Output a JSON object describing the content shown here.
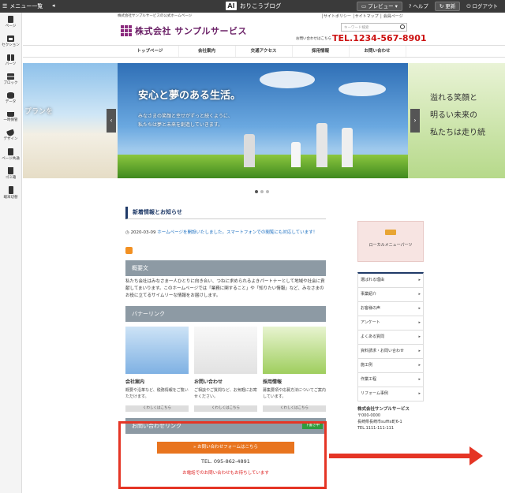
{
  "toolbar": {
    "menu_label": "メニュー一覧",
    "collapse_glyph": "◂",
    "brand": "おりこうブログ",
    "brand_mark": "AI",
    "preview": "プレビュー",
    "help": "ヘルプ",
    "update": "更新",
    "logout": "ログアウト"
  },
  "sidebar": {
    "items": [
      {
        "label": "ページ",
        "icon": "page-icon"
      },
      {
        "label": "セクション",
        "icon": "section-icon"
      },
      {
        "label": "パーツ",
        "icon": "parts-icon"
      },
      {
        "label": "ブロック",
        "icon": "block-icon"
      },
      {
        "label": "データ",
        "icon": "database-icon"
      },
      {
        "label": "一時保管",
        "icon": "tray-icon"
      },
      {
        "label": "デザイン",
        "icon": "paint-bucket-icon"
      },
      {
        "label": "ページ共通",
        "icon": "common-page-icon"
      },
      {
        "label": "ゴミ箱",
        "icon": "trash-icon"
      },
      {
        "label": "端末切替",
        "icon": "phone-icon"
      }
    ]
  },
  "site": {
    "tagline": "株式会社サンプルサービスの公式ホームページ",
    "top_links": "│サイトポリシー │サイトマップ │ 会員ページ",
    "logo_text": "株式会社 サンプルサービス",
    "search_placeholder": "キーワード検索",
    "tel_note": "お問い合わせはこちら",
    "tel": "TEL.1234-567-8901",
    "nav": [
      "トップページ",
      "会社案内",
      "交通アクセス",
      "採用情報",
      "お問い合わせ"
    ],
    "hero": {
      "left_text": "プランを",
      "title": "安心と夢のある生活。",
      "subtitle": "みなさまの笑顔と幸せがずっと続くように、\n私たちは夢と未来を創造していきます。",
      "right_text": "溢れる笑顔と\n明るい未来の\n私たちは走り続",
      "prev_glyph": "‹",
      "next_glyph": "›"
    },
    "news": {
      "title": "新着情報とお知らせ",
      "date": "2020-03-09",
      "text": "ホームページを開設いたしました。スマートフォンでの閲覧にも対応しています！"
    },
    "overview": {
      "title": "概要文",
      "text": "私たち会社はみなさま一人ひとりに向き合い、つねに求められるよきパートナーとして地域や社会に貢献してまいります。このホームページでは「業務に関すること」や「知りたい情報」など、みなさまのお役に立てるサイムリーな情報をお届けします。"
    },
    "banner": {
      "title": "バナーリンク",
      "cards": [
        {
          "title": "会社案内",
          "text": "概要や沿革など、税務情報をご覧いただけます。",
          "more": "くわしくはこちら"
        },
        {
          "title": "お問い合わせ",
          "text": "ご相談やご質問など、お気軽にお寄せください。",
          "more": "くわしくはこちら"
        },
        {
          "title": "採用情報",
          "text": "募集要項や応募方法についてご案内しています。",
          "more": "くわしくはこちら"
        }
      ]
    },
    "contact": {
      "title": "お問い合わせリンク",
      "badge": "下書き中",
      "button": "» お問い合わせフォームはこちら",
      "tel": "TEL. 095-862-4891",
      "note": "お電話でのお問い合わせもお待ちしています"
    },
    "local_menu": "ローカルメニューパーツ",
    "right_menu": [
      "選ばれる理由",
      "事業紹介",
      "お客様の声",
      "アンケート",
      "よくある質問",
      "資料請求・お問い合わせ",
      "施工例",
      "作業工程",
      "リフォーム事例"
    ],
    "company": {
      "name": "株式会社サンプルサービス",
      "zip": "〒000-0000",
      "address": "長崎県長崎市suffix町6-1",
      "tel": "TEL.1111-111-111"
    }
  },
  "colors": {
    "accent_red": "#e53525",
    "brand_purple": "#6b2167",
    "tel_red": "#cc1111",
    "contact_orange": "#e8741f"
  }
}
